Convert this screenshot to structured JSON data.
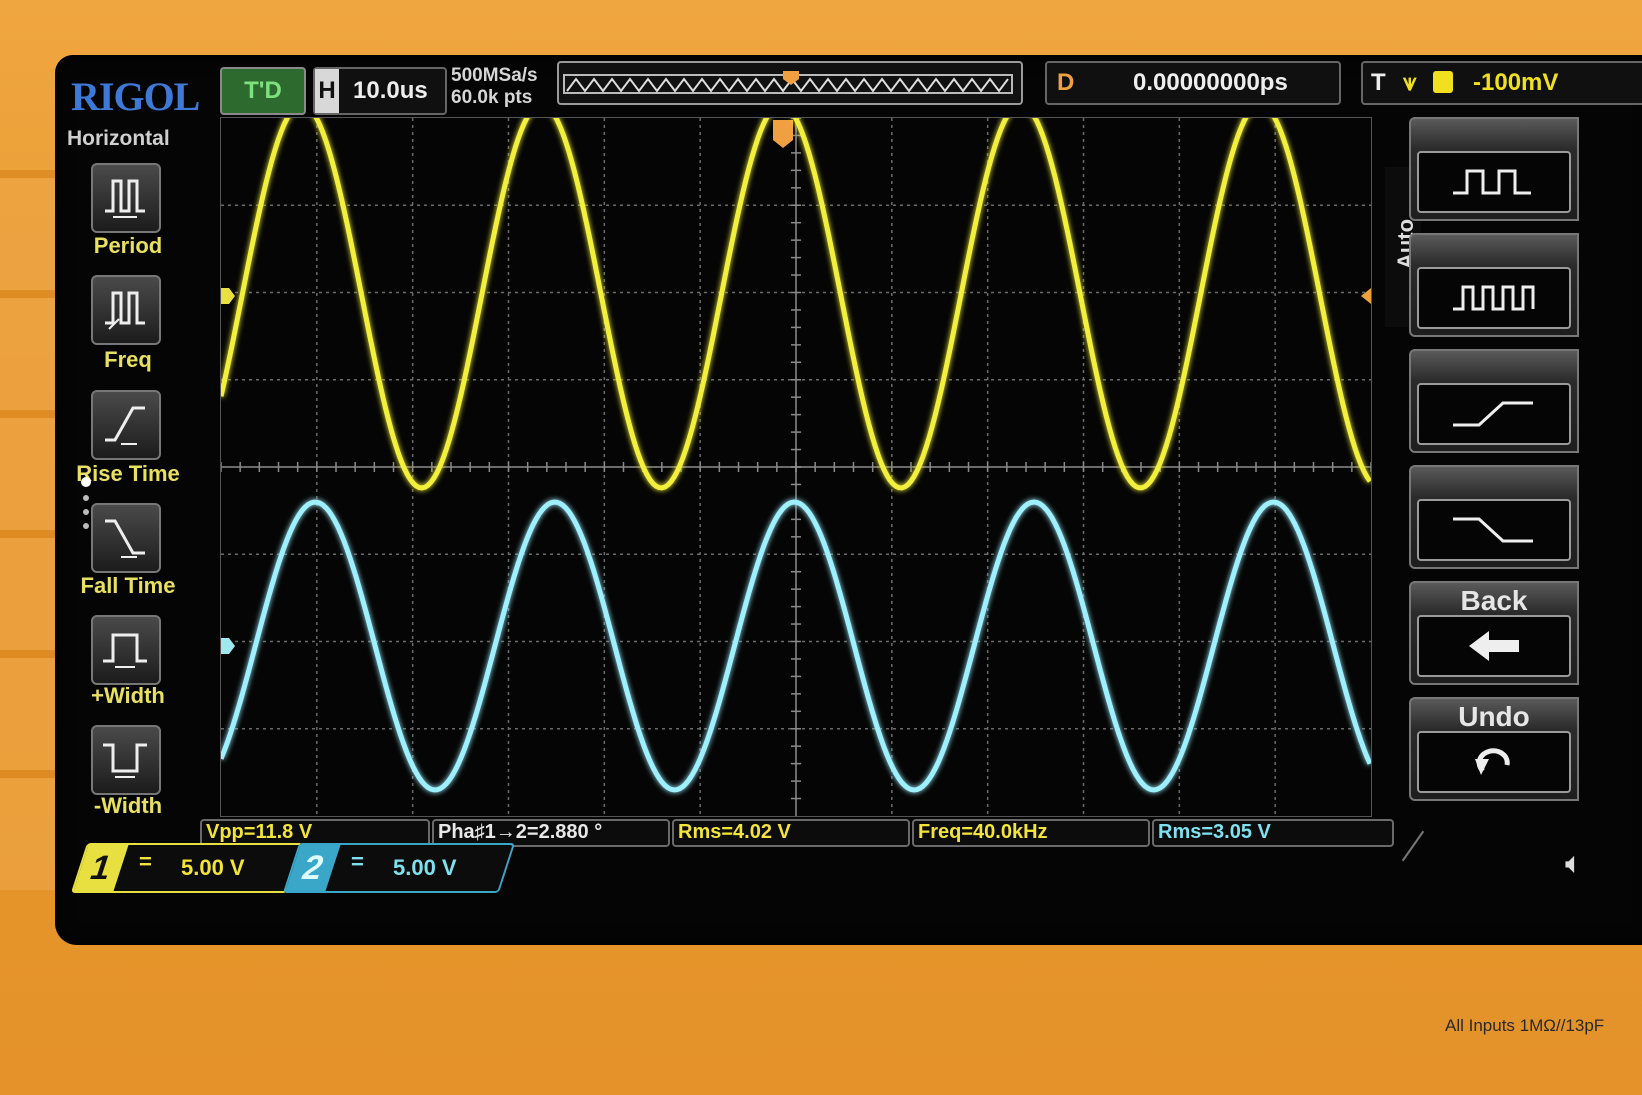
{
  "brand": "RIGOL",
  "top_bar": {
    "trigger_mode": "T'D",
    "horizontal_key": "H",
    "timebase": "10.0us",
    "sample_rate": "500MSa/s",
    "memory_depth": "60.0k pts",
    "delay_key": "D",
    "delay_value": "0.00000000ps",
    "trigger_key": "T",
    "trigger_slope": "rising-edge-icon",
    "trigger_level": "-100mV"
  },
  "left_menu": {
    "title": "Horizontal",
    "items": [
      {
        "label": "Period",
        "icon": "period-icon"
      },
      {
        "label": "Freq",
        "icon": "freq-icon"
      },
      {
        "label": "Rise Time",
        "icon": "rise-time-icon"
      },
      {
        "label": "Fall Time",
        "icon": "fall-time-icon"
      },
      {
        "label": "+Width",
        "icon": "positive-width-icon"
      },
      {
        "label": "-Width",
        "icon": "negative-width-icon"
      }
    ]
  },
  "right_menu": {
    "auto_label": "Auto",
    "buttons": [
      {
        "label": "",
        "icon": "period-pulse-icon"
      },
      {
        "label": "",
        "icon": "freq-pulse-icon"
      },
      {
        "label": "",
        "icon": "rise-edge-icon"
      },
      {
        "label": "",
        "icon": "fall-edge-icon"
      },
      {
        "label": "Back",
        "icon": "back-arrow-icon"
      },
      {
        "label": "Undo",
        "icon": "undo-icon"
      }
    ]
  },
  "measurements": [
    {
      "text": "Vpp=11.8 V",
      "color": "#f2e43a"
    },
    {
      "text": "Pha♯1→2=2.880 °",
      "color": "#e8e8e8"
    },
    {
      "text": "Rms=4.02 V",
      "color": "#f2e43a"
    },
    {
      "text": "Freq=40.0kHz",
      "color": "#f2e43a"
    },
    {
      "text": "Rms=3.05 V",
      "color": "#7fe0ee"
    }
  ],
  "channels": [
    {
      "number": "1",
      "coupling": "=",
      "scale": "5.00 V",
      "color": "#e8e040"
    },
    {
      "number": "2",
      "coupling": "=",
      "scale": "5.00 V",
      "color": "#3aa6c8"
    }
  ],
  "waveforms": {
    "ch1": {
      "color": "#f2f03c",
      "cycles": 4.8,
      "amplitude_div": 2.2
    },
    "ch2": {
      "color": "#9ff0ff",
      "cycles": 4.8,
      "amplitude_div": 1.65
    }
  },
  "speaker_icon": "speaker-mute-icon",
  "footer_label": "All Inputs 1MΩ//13pF"
}
